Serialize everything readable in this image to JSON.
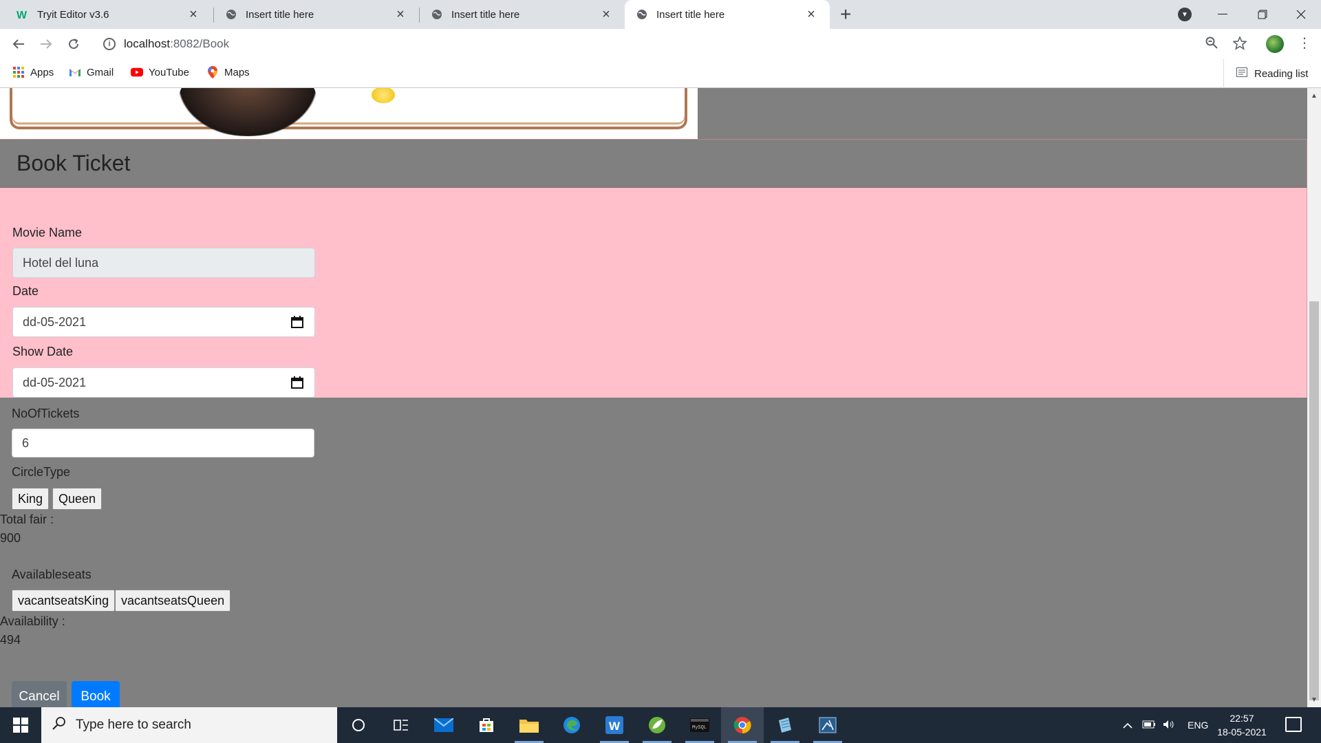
{
  "browser": {
    "tabs": [
      {
        "title": "Tryit Editor v3.6",
        "favicon": "w3schools-icon",
        "active": false
      },
      {
        "title": "Insert title here",
        "favicon": "globe-icon",
        "active": false
      },
      {
        "title": "Insert title here",
        "favicon": "globe-icon",
        "active": false
      },
      {
        "title": "Insert title here",
        "favicon": "globe-icon",
        "active": true
      }
    ],
    "url_host": "localhost",
    "url_rest": ":8082/Book",
    "bookmarks": [
      {
        "label": "Apps",
        "icon": "apps-grid-icon"
      },
      {
        "label": "Gmail",
        "icon": "gmail-icon"
      },
      {
        "label": "YouTube",
        "icon": "youtube-icon"
      },
      {
        "label": "Maps",
        "icon": "maps-icon"
      }
    ],
    "reading_list": "Reading list"
  },
  "page": {
    "header_title": "Book Ticket",
    "movie_name_label": "Movie Name",
    "movie_name_value": "Hotel del luna",
    "date_label": "Date",
    "date_value": "dd-05-2021",
    "show_date_label": "Show Date",
    "show_date_value": "dd-05-2021",
    "tickets_label": "NoOfTickets",
    "tickets_value": "6",
    "circle_label": "CircleType",
    "circle_options": [
      "King",
      "Queen"
    ],
    "total_fair_label": "Total fair :",
    "total_fair_value": "900",
    "available_label": "Availableseats",
    "seat_options": [
      "vacantseatsKing",
      "vacantseatsQueen"
    ],
    "availability_label": "Availability :",
    "availability_value": "494",
    "cancel_label": "Cancel",
    "book_label": "Book"
  },
  "colors": {
    "page_background": "#808080",
    "form_pink": "#ffc0cb",
    "primary_button": "#007bff",
    "secondary_button": "#6c757d"
  },
  "taskbar": {
    "search_placeholder": "Type here to search",
    "language": "ENG",
    "time": "22:57",
    "date": "18-05-2021"
  }
}
